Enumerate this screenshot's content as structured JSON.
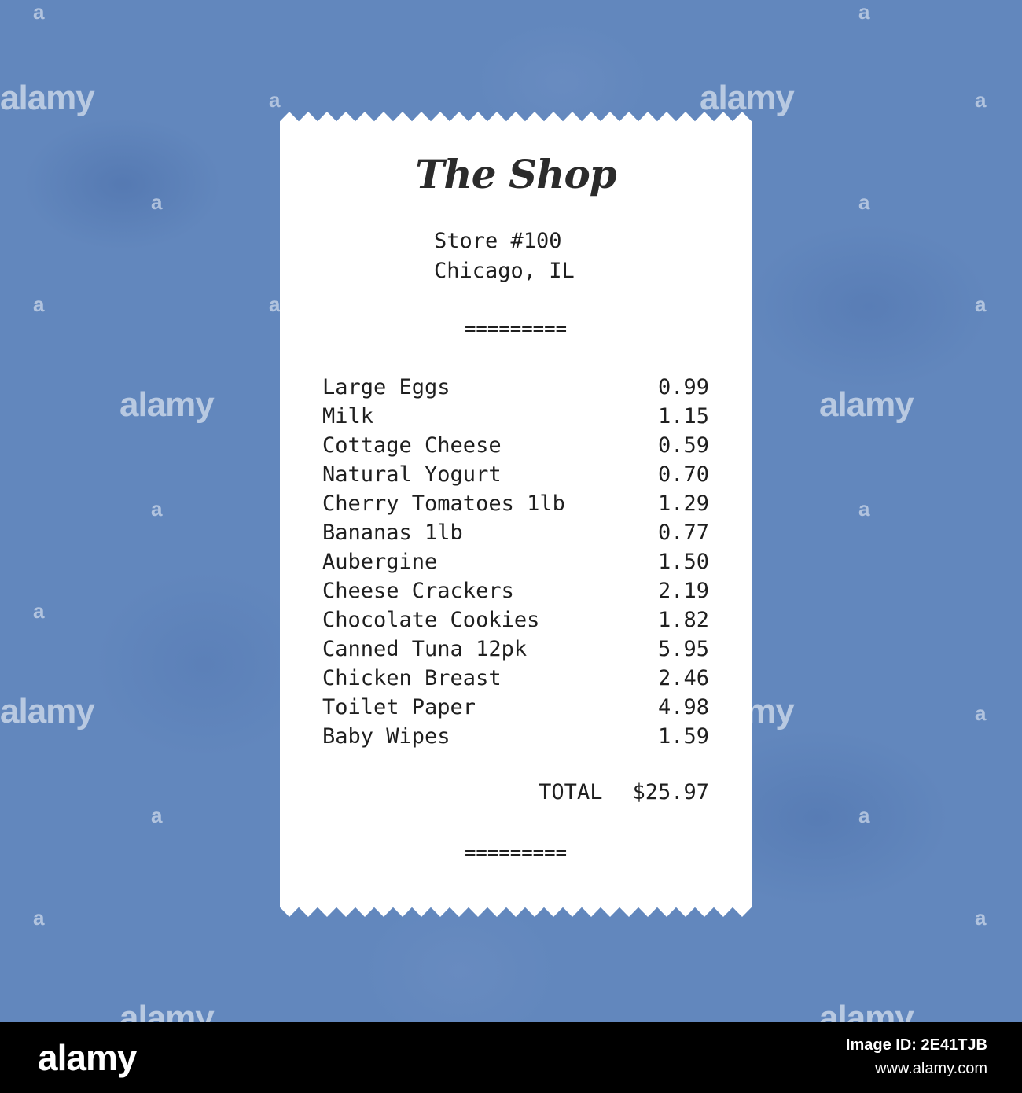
{
  "receipt": {
    "shop_name": "The Shop",
    "store_number": "Store #100",
    "location": "Chicago, IL",
    "separator_top": "=========",
    "items": [
      {
        "name": "Large Eggs",
        "price": "0.99"
      },
      {
        "name": "Milk",
        "price": "1.15"
      },
      {
        "name": "Cottage Cheese",
        "price": "0.59"
      },
      {
        "name": "Natural Yogurt",
        "price": "0.70"
      },
      {
        "name": "Cherry Tomatoes 1lb",
        "price": "1.29"
      },
      {
        "name": "Bananas 1lb",
        "price": "0.77"
      },
      {
        "name": "Aubergine",
        "price": "1.50"
      },
      {
        "name": "Cheese Crackers",
        "price": "2.19"
      },
      {
        "name": "Chocolate Cookies",
        "price": "1.82"
      },
      {
        "name": "Canned Tuna 12pk",
        "price": "5.95"
      },
      {
        "name": "Chicken Breast",
        "price": "2.46"
      },
      {
        "name": "Toilet Paper",
        "price": "4.98"
      },
      {
        "name": "Baby Wipes",
        "price": "1.59"
      }
    ],
    "total_label": "TOTAL",
    "total_value": "$25.97",
    "separator_bottom": "========="
  },
  "watermark": {
    "text": "alamy",
    "short": "a"
  },
  "footer": {
    "logo": "alamy",
    "image_id": "Image ID: 2E41TJB",
    "site": "www.alamy.com"
  },
  "colors": {
    "background": "#6287bd",
    "paper": "#ffffff",
    "text": "#1f1f1f",
    "footer": "#000000"
  }
}
